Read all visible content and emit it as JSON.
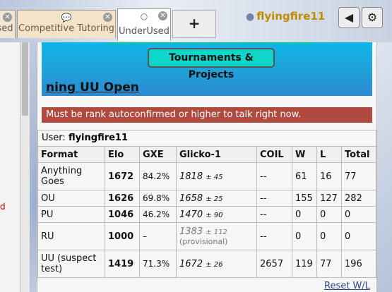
{
  "tabs": [
    {
      "label": "sed",
      "icon": "chat-icon"
    },
    {
      "label": "Competitive Tutoring",
      "icon": "chat-icon"
    },
    {
      "label": "UnderUsed",
      "icon": "chat-bubble-icon"
    }
  ],
  "new_tab_label": "+",
  "user": {
    "name": "flyingfire11"
  },
  "left_panel_fragment": "d",
  "banner": {
    "button_label": "Tournaments & Projects",
    "title": "ning UU Open"
  },
  "error_message": "Must be rank autoconfirmed or higher to talk right now.",
  "ladder": {
    "user_label": "User:",
    "user_name": "flyingfire11",
    "headers": [
      "Format",
      "Elo",
      "GXE",
      "Glicko-1",
      "COIL",
      "W",
      "L",
      "Total"
    ],
    "rows": [
      {
        "format": "Anything Goes",
        "elo": "1672",
        "gxe": "84.2%",
        "glicko": "1818",
        "dev": "± 45",
        "coil": "--",
        "w": "61",
        "l": "16",
        "total": "77"
      },
      {
        "format": "OU",
        "elo": "1626",
        "gxe": "69.8%",
        "glicko": "1658",
        "dev": "± 25",
        "coil": "--",
        "w": "155",
        "l": "127",
        "total": "282"
      },
      {
        "format": "PU",
        "elo": "1046",
        "gxe": "46.2%",
        "glicko": "1470",
        "dev": "± 90",
        "coil": "--",
        "w": "0",
        "l": "0",
        "total": "0"
      },
      {
        "format": "RU",
        "elo": "1000",
        "gxe": "–",
        "glicko": "1383",
        "dev": "± 112",
        "provisional": "(provisional)",
        "coil": "--",
        "w": "0",
        "l": "0",
        "total": "0"
      },
      {
        "format": "UU (suspect test)",
        "elo": "1419",
        "gxe": "71.3%",
        "glicko": "1672",
        "dev": "± 26",
        "coil": "2657",
        "w": "119",
        "l": "77",
        "total": "196"
      }
    ],
    "reset_label": "Reset W/L"
  }
}
